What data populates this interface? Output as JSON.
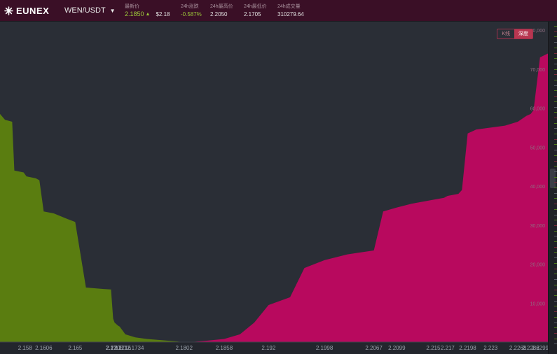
{
  "header": {
    "brand": "EUNEX",
    "pair": "WEN/USDT",
    "stats": {
      "last_label": "最新价",
      "last_price": "2.1850",
      "last_usd": "$2.18",
      "change_label": "24h涨跌",
      "change_value": "-0.587%",
      "high_label": "24h最高价",
      "high_value": "2.2050",
      "low_label": "24h最低价",
      "low_value": "2.1705",
      "volume_label": "24h成交量",
      "volume_value": "310279.64"
    }
  },
  "toggle": {
    "kline_label": "K线",
    "depth_label": "深度",
    "active": "depth"
  },
  "colors": {
    "bid": "#5a7d10",
    "ask": "#b8095e",
    "background": "#2a2e36",
    "header": "#3a0f26",
    "up": "#9cc93a"
  },
  "chart_data": {
    "type": "area",
    "xlabel": "",
    "ylabel": "",
    "x_ticks": [
      "2.158",
      "2.1606",
      "2.165",
      "2.17",
      "2.1705",
      "2.1711",
      "2.1716",
      "2.1734",
      "2.1802",
      "2.1858",
      "2.192",
      "2.1998",
      "2.2067",
      "2.2099",
      "2.215",
      "2.217",
      "2.2198",
      "2.223",
      "2.2268",
      "2.2286",
      "2.2299"
    ],
    "y_ticks": [
      "10,000",
      "20,000",
      "30,000",
      "40,000",
      "50,000",
      "60,000",
      "70,000",
      "80,000"
    ],
    "ylim": [
      0,
      80000
    ],
    "series": [
      {
        "side": "bid",
        "points": [
          [
            2.1545,
            58500
          ],
          [
            2.1552,
            57000
          ],
          [
            2.1562,
            56500
          ],
          [
            2.1565,
            44000
          ],
          [
            2.1578,
            43500
          ],
          [
            2.1582,
            42500
          ],
          [
            2.1595,
            42000
          ],
          [
            2.16,
            41500
          ],
          [
            2.1606,
            33500
          ],
          [
            2.162,
            33000
          ],
          [
            2.164,
            31500
          ],
          [
            2.165,
            30800
          ],
          [
            2.1665,
            14000
          ],
          [
            2.169,
            13600
          ],
          [
            2.17,
            13500
          ],
          [
            2.1703,
            6000
          ],
          [
            2.1705,
            5000
          ],
          [
            2.171,
            4200
          ],
          [
            2.1712,
            4000
          ],
          [
            2.1716,
            3000
          ],
          [
            2.172,
            2000
          ],
          [
            2.1734,
            1200
          ],
          [
            2.175,
            800
          ],
          [
            2.179,
            200
          ],
          [
            2.1802,
            0
          ]
        ]
      },
      {
        "side": "ask",
        "points": [
          [
            2.181,
            0
          ],
          [
            2.183,
            300
          ],
          [
            2.1858,
            800
          ],
          [
            2.188,
            2000
          ],
          [
            2.19,
            5000
          ],
          [
            2.192,
            9500
          ],
          [
            2.195,
            11500
          ],
          [
            2.197,
            19000
          ],
          [
            2.1998,
            21000
          ],
          [
            2.203,
            22500
          ],
          [
            2.2067,
            23500
          ],
          [
            2.208,
            33500
          ],
          [
            2.2099,
            34500
          ],
          [
            2.212,
            35500
          ],
          [
            2.215,
            36500
          ],
          [
            2.2165,
            37000
          ],
          [
            2.217,
            37500
          ],
          [
            2.2185,
            38000
          ],
          [
            2.219,
            39000
          ],
          [
            2.2198,
            53500
          ],
          [
            2.221,
            54500
          ],
          [
            2.223,
            55000
          ],
          [
            2.225,
            55500
          ],
          [
            2.2268,
            56500
          ],
          [
            2.228,
            58000
          ],
          [
            2.2286,
            58500
          ],
          [
            2.229,
            59500
          ],
          [
            2.2299,
            73000
          ],
          [
            2.231,
            74000
          ]
        ]
      }
    ]
  }
}
